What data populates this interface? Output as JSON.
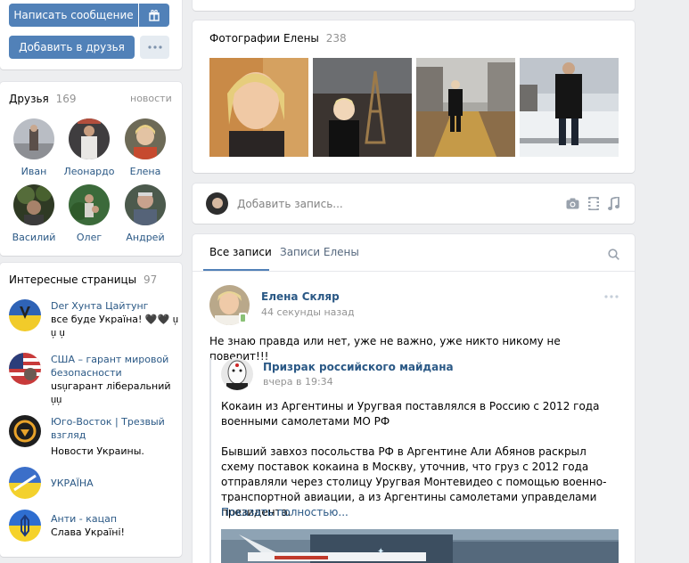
{
  "buttons": {
    "write_message": "Написать сообщение",
    "add_friend": "Добавить в друзья"
  },
  "friends": {
    "title": "Друзья",
    "count": "169",
    "news_link": "новости",
    "items": [
      {
        "name": "Иван"
      },
      {
        "name": "Леонардо"
      },
      {
        "name": "Елена"
      },
      {
        "name": "Василий"
      },
      {
        "name": "Олег"
      },
      {
        "name": "Андрей"
      }
    ]
  },
  "interesting": {
    "title": "Интересные страницы",
    "count": "97",
    "items": [
      {
        "name": "Der Хунта Цайтунг",
        "desc": "все буде Україна! 🖤🖤 u᷊ u᷊ u᷊"
      },
      {
        "name": "США – гарант мировой безопасности",
        "desc": "usu᷊гарант ліберальний u᷊u᷊"
      },
      {
        "name": "Юго-Восток | Трезвый взгляд",
        "desc": "Новости Украины."
      },
      {
        "name": "УКРАЇНА",
        "desc": ""
      },
      {
        "name": "Анти - кацап",
        "desc": "Слава Україні!"
      }
    ]
  },
  "photos": {
    "title": "Фотографии Елены",
    "count": "238"
  },
  "composer": {
    "placeholder": "Добавить запись..."
  },
  "wall": {
    "tabs": [
      "Все записи",
      "Записи Елены"
    ]
  },
  "post": {
    "author": "Елена Скляр",
    "time": "44 секунды назад",
    "text": "Не знаю правда или нет, уже не важно, уже никто никому не поверит!!!",
    "repost": {
      "author": "Призрак российского майдана",
      "time": "вчера в 19:34",
      "para1": "Кокаин из Аргентины и Уругвая поставлялся в Россию с 2012 года военными самолетами МО РФ",
      "para2": "Бывший завхоз посольства РФ в Аргентине Али Абянов раскрыл схему поставок кокаина в Москву, уточнив, что груз с 2012 года отправляли через столицу Уругвая Монтевидео с помощью военно-транспортной авиации, а из Аргентины самолетами управделами президента.",
      "show_more": "Показать полностью..."
    }
  },
  "colors": {
    "accent": "#5181b8",
    "link": "#2a5885",
    "background": "#edeef0"
  }
}
